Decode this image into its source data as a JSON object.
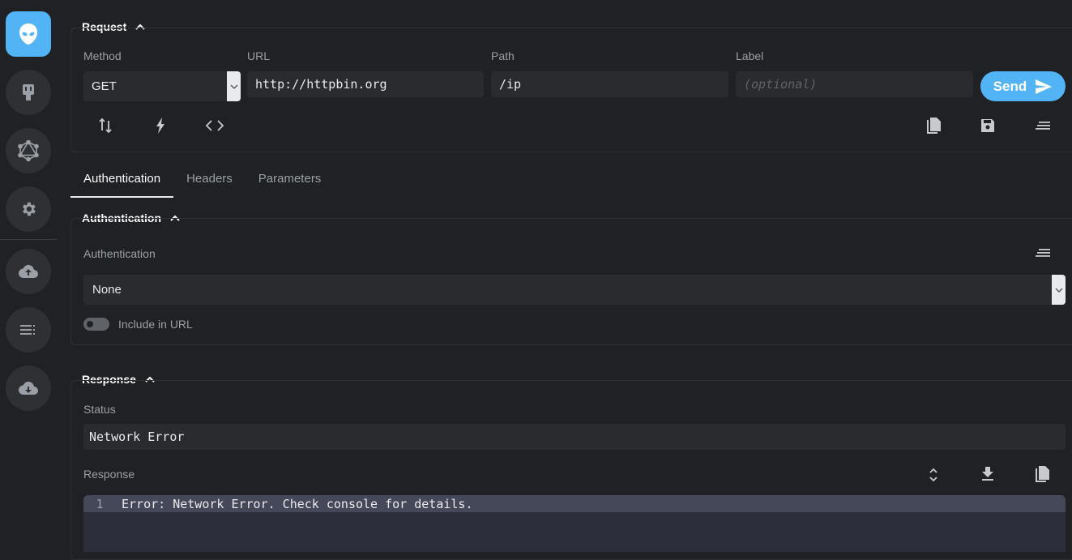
{
  "request": {
    "title": "Request",
    "method_label": "Method",
    "method_value": "GET",
    "url_label": "URL",
    "url_value": "http://httpbin.org",
    "path_label": "Path",
    "path_value": "/ip",
    "label_label": "Label",
    "label_placeholder": "(optional)",
    "send_label": "Send"
  },
  "tabs": [
    {
      "label": "Authentication",
      "active": true
    },
    {
      "label": "Headers",
      "active": false
    },
    {
      "label": "Parameters",
      "active": false
    }
  ],
  "auth": {
    "title": "Authentication",
    "field_label": "Authentication",
    "value": "None",
    "include_label": "Include in URL"
  },
  "response": {
    "title": "Response",
    "status_label": "Status",
    "status_value": "Network Error",
    "response_label": "Response",
    "line_number": "1",
    "line_text": "Error: Network Error. Check console for details."
  },
  "colors": {
    "accent": "#52b4f5",
    "background": "#202124",
    "panel": "#2a2b2e"
  },
  "icons": {
    "sidebar": [
      "alien-icon",
      "plug-icon",
      "graphql-icon",
      "gear-icon",
      "cloud-upload-icon",
      "list-icon",
      "cloud-download-icon"
    ],
    "request_left": [
      "swap-vertical-icon",
      "flash-icon",
      "code-icon"
    ],
    "request_right": [
      "copy-icon",
      "save-icon",
      "sort-icon"
    ]
  }
}
